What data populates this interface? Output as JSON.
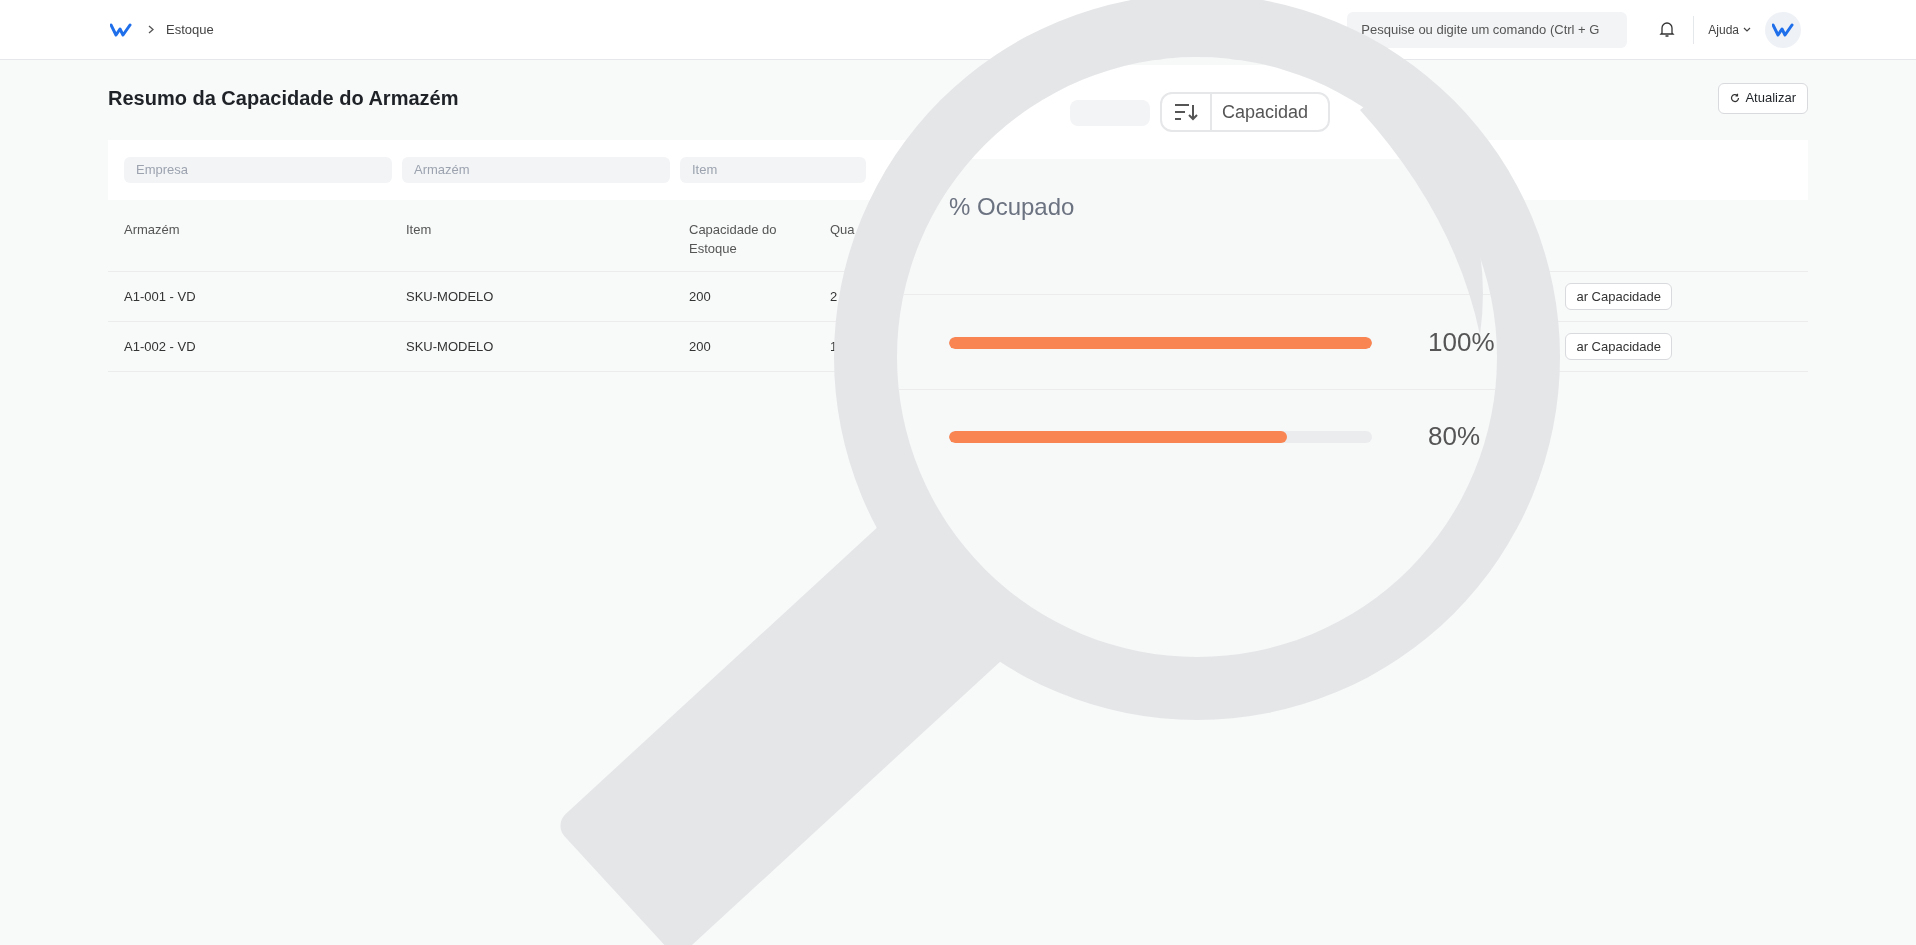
{
  "topbar": {
    "breadcrumb": "Estoque",
    "search": {
      "placeholder": "Pesquise ou digite um comando (Ctrl + G"
    },
    "help": "Ajuda"
  },
  "page": {
    "title": "Resumo da Capacidade do Armazém",
    "refresh_button": "Atualizar"
  },
  "filters": [
    {
      "placeholder": "Empresa"
    },
    {
      "placeholder": "Armazém"
    },
    {
      "placeholder": "Item"
    }
  ],
  "table": {
    "columns": [
      "Armazém",
      "Item",
      "Capacidade do Estoque",
      "Qua"
    ],
    "rows": [
      {
        "cells": [
          "A1-001 - VD",
          "SKU-MODELO",
          "200",
          "2"
        ],
        "action": "ar Capacidade"
      },
      {
        "cells": [
          "A1-002 - VD",
          "SKU-MODELO",
          "200",
          "1"
        ],
        "action": "ar Capacidade"
      }
    ]
  },
  "magnifier": {
    "sort_label": "Capacidad",
    "column": "% Ocupado",
    "rows": [
      {
        "level": 1,
        "reading": "100%"
      },
      {
        "level": 0.8,
        "reading": "80%"
      }
    ]
  }
}
